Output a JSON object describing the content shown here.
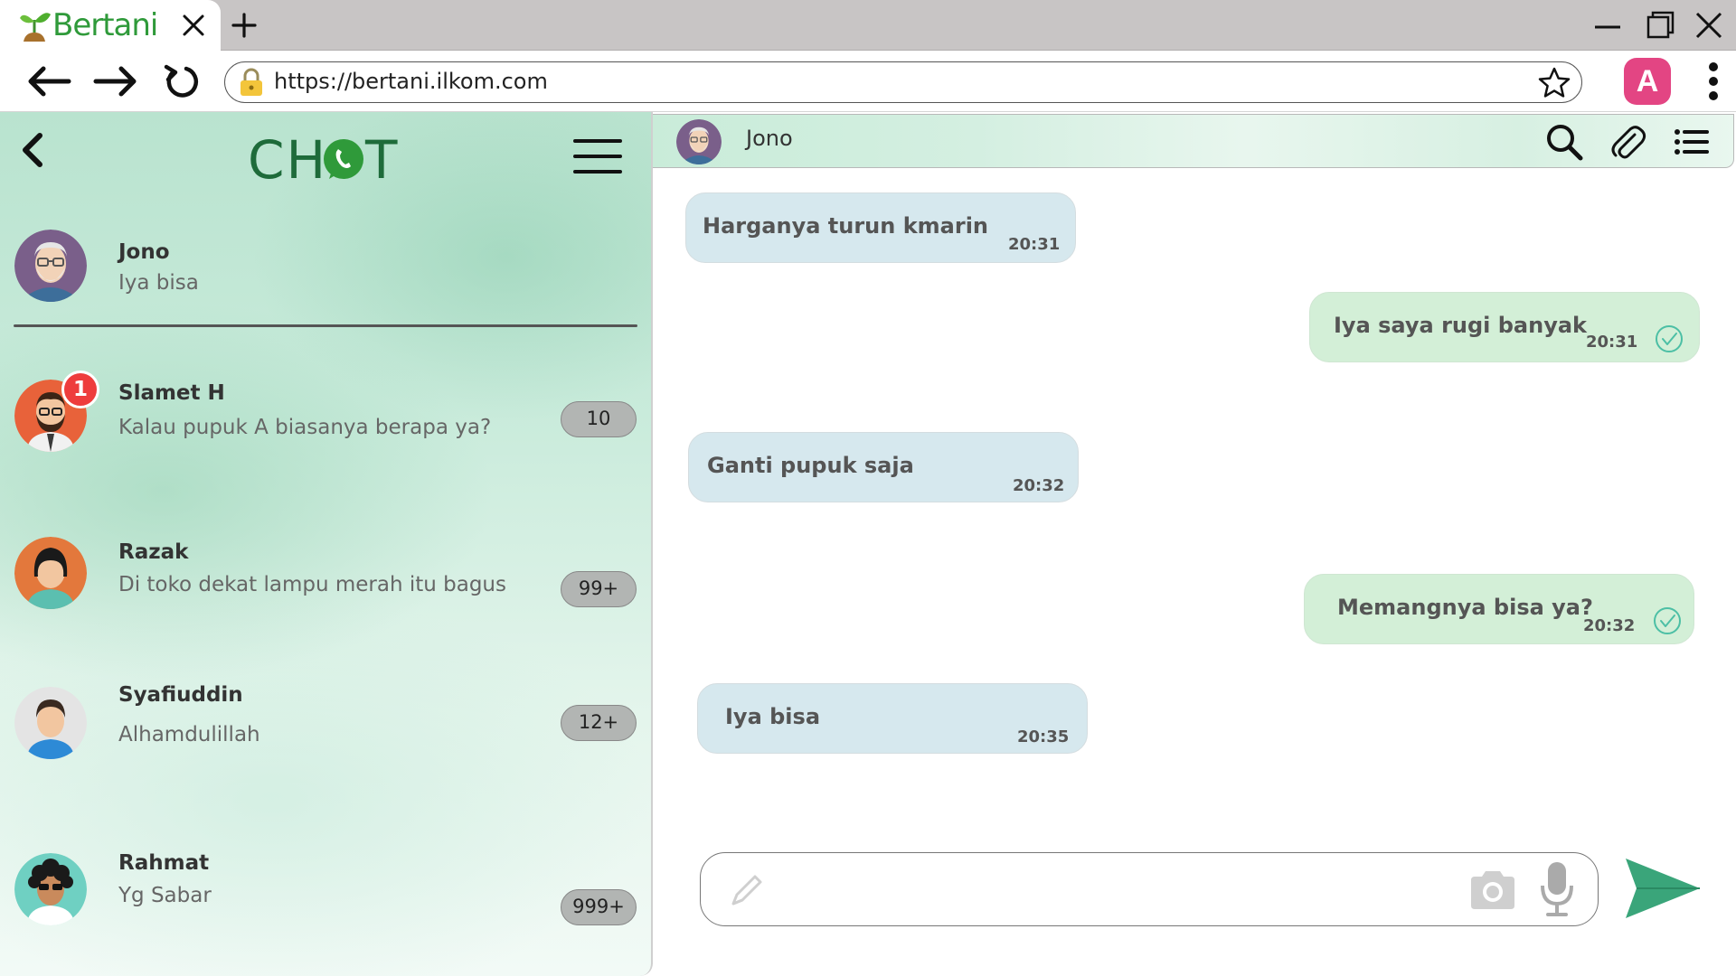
{
  "browser": {
    "tab_title": "Bertani",
    "url": "https://bertani.ilkom.com",
    "profile_initial": "A",
    "icons": [
      "sprout-logo-icon",
      "close-icon",
      "plus-icon",
      "minimize-icon",
      "maximize-icon",
      "window-close-icon",
      "back-arrow-icon",
      "forward-arrow-icon",
      "reload-icon",
      "lock-icon",
      "star-icon",
      "kebab-menu-icon"
    ]
  },
  "chat_list": {
    "logo_text": "CH T",
    "contacts": [
      {
        "name": "Jono",
        "last_message": "Iya bisa",
        "count": null,
        "unread": null,
        "active": true
      },
      {
        "name": "Slamet H",
        "last_message": "Kalau pupuk A biasanya berapa ya?",
        "count": "10",
        "unread": "1"
      },
      {
        "name": "Razak",
        "last_message": "Di toko dekat lampu merah itu bagus",
        "count": "99+"
      },
      {
        "name": "Syafiuddin",
        "last_message": "Alhamdulillah",
        "count": "12+"
      },
      {
        "name": "Rahmat",
        "last_message": "Yg Sabar",
        "count": "999+"
      }
    ]
  },
  "conversation": {
    "contact_name": "Jono",
    "messages": [
      {
        "direction": "in",
        "text": "Harganya turun kmarin",
        "time": "20:31"
      },
      {
        "direction": "out",
        "text": "Iya saya rugi banyak",
        "time": "20:31",
        "read": true
      },
      {
        "direction": "in",
        "text": "Ganti pupuk saja",
        "time": "20:32"
      },
      {
        "direction": "out",
        "text": "Memangnya bisa ya?",
        "time": "20:32",
        "read": true
      },
      {
        "direction": "in",
        "text": "Iya bisa",
        "time": "20:35"
      }
    ],
    "composer_placeholder": ""
  },
  "colors": {
    "brand_green": "#2f9a3a",
    "chat_green": "#1e6b3a",
    "send_green": "#3aa57a",
    "bubble_in": "#d6e8ee",
    "bubble_out": "#d3efd7",
    "unread_red": "#ee3d3d",
    "profile_pink": "#e34583"
  }
}
